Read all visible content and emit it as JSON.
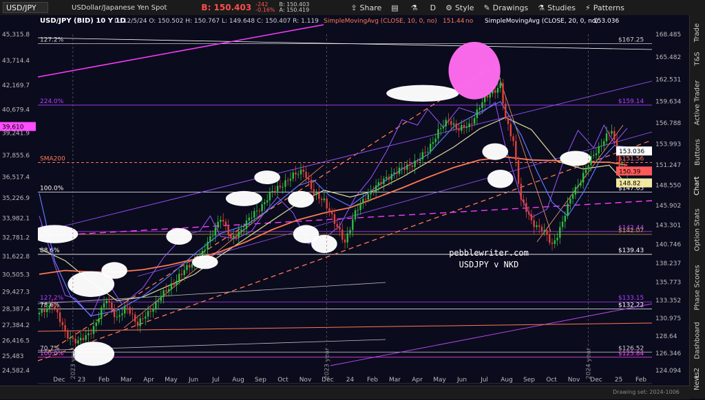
{
  "toolbar": {
    "symbol": "USD/JPY",
    "description": "USDollar/Japanese Yen Spot",
    "bid": "B: 150.403",
    "change": "-242",
    "change_pct": "-0.16%",
    "bid_small": "B: 150.403",
    "ask_small": "A: 150.419",
    "buttons": [
      "Share",
      "Style",
      "Drawings",
      "Studies",
      "Patterns"
    ],
    "period": "D"
  },
  "chart_header": {
    "title": "USD/JPY (BID) 10 Y 1D",
    "ohlc": "D: 12/5/24  O: 150.502  H: 150.767  L: 149.648  C: 150.407  R: 1.119",
    "sma10": "SimpleMovingAvg (CLOSE, 10, 0, no)",
    "sma10_val": "151.44",
    "sma10_no": "no",
    "sma20": "SimpleMovingAvg (CLOSE, 20, 0, no)",
    "sma20_val": "153.036"
  },
  "colors": {
    "background": "#0b0b1e",
    "magenta": "#ff3cff",
    "orange": "#ff7a52",
    "violet": "#9a56ff",
    "yellow_sma": "#dede9a",
    "blue_sma": "#5a7bff",
    "candle_up": "#2fbf3f",
    "candle_down": "#e0433a"
  },
  "watermark": {
    "line1": "pebblewriter.com",
    "line2": "USDJPY v NKD"
  },
  "vertical_labels": [
    "2023 year",
    "2023 year",
    "2024 year"
  ],
  "chart_data": {
    "type": "candlestick",
    "x_ticks": [
      "Dec",
      "23",
      "Feb",
      "Mar",
      "Apr",
      "May",
      "Jun",
      "Jul",
      "Aug",
      "Sep",
      "Oct",
      "Nov",
      "Dec",
      "24",
      "Feb",
      "Mar",
      "Apr",
      "May",
      "Jun",
      "Jul",
      "Aug",
      "Sep",
      "Oct",
      "Nov",
      "Dec",
      "25",
      "Feb"
    ],
    "right_axis_ticks": [
      "168.485",
      "165.482",
      "162.531",
      "159.634",
      "156.788",
      "153.993",
      "151.247",
      "148.550",
      "145.902",
      "143.301",
      "140.746",
      "138.237",
      "135.773",
      "133.352",
      "130.975",
      "128.64",
      "126.346",
      "124.094"
    ],
    "left_axis_ticks": [
      "45,315.8",
      "43,714.4",
      "42,169.7",
      "40,679.4",
      "39,241.9",
      "37,855.6",
      "36,517.4",
      "35,226.9",
      "33,982.1",
      "32,781.2",
      "31,622.8",
      "30,505.3",
      "29,427.3",
      "28,387.4",
      "27,384.2",
      "26,416.5",
      "25,483",
      "24,582.4"
    ],
    "ylim": [
      124.094,
      168.485
    ],
    "left_ylim": [
      24582.4,
      45315.8
    ],
    "price_badges": [
      {
        "label": "153.036",
        "value": 153.036,
        "color": "#ffffff"
      },
      {
        "label": "150.39",
        "value": 150.39,
        "color": "#ff5a5a"
      },
      {
        "label": "148.82",
        "value": 148.82,
        "color": "#f3e9a0"
      }
    ],
    "left_badge": {
      "label": "39,610",
      "value": 39610,
      "color": "#ff4dff"
    },
    "fib_levels": [
      {
        "pct": "127.2%",
        "price": "$167.25",
        "value": 167.25,
        "color": "#cfcfcf"
      },
      {
        "pct": "224.0%",
        "price": "$159.14",
        "value": 159.14,
        "color": "#b040ff"
      },
      {
        "pct": "SMA200",
        "price": "$151.56",
        "value": 151.56,
        "color": "#ff7a52"
      },
      {
        "pct": "100.0%",
        "price": "$147.65",
        "value": 147.65,
        "color": "#ffffff"
      },
      {
        "pct": "161.8%",
        "price": "$142.44",
        "value": 142.44,
        "color": "#c74aff"
      },
      {
        "pct": "",
        "price": "$142.07",
        "value": 142.07,
        "color": "#c9a040"
      },
      {
        "pct": "88.6%",
        "price": "$139.43",
        "value": 139.43,
        "color": "#ffffff"
      },
      {
        "pct": "127.2%",
        "price": "$133.15",
        "value": 133.15,
        "color": "#b040ff"
      },
      {
        "pct": "78.6%",
        "price": "$132.22",
        "value": 132.22,
        "color": "#ffffff"
      },
      {
        "pct": "70.7%",
        "price": "$126.52",
        "value": 126.52,
        "color": "#cfcfcf"
      },
      {
        "pct": "100.0%",
        "price": "$125.84",
        "value": 125.84,
        "color": "#ff4dff"
      }
    ],
    "usdjpy_path": [
      [
        0,
        131.5
      ],
      [
        5,
        133
      ],
      [
        10,
        129
      ],
      [
        15,
        127.8
      ],
      [
        18,
        128.5
      ],
      [
        22,
        130.4
      ],
      [
        26,
        133.5
      ],
      [
        30,
        131
      ],
      [
        34,
        132.4
      ],
      [
        38,
        130.3
      ],
      [
        42,
        131.5
      ],
      [
        46,
        133.6
      ],
      [
        50,
        134.8
      ],
      [
        54,
        136.7
      ],
      [
        58,
        137.8
      ],
      [
        62,
        139.1
      ],
      [
        66,
        141.4
      ],
      [
        70,
        144.5
      ],
      [
        74,
        141.3
      ],
      [
        78,
        142.8
      ],
      [
        82,
        144.4
      ],
      [
        86,
        146
      ],
      [
        90,
        147.6
      ],
      [
        94,
        148.8
      ],
      [
        98,
        149.7
      ],
      [
        102,
        150.7
      ],
      [
        106,
        147.2
      ],
      [
        110,
        146.7
      ],
      [
        114,
        143.5
      ],
      [
        118,
        141.2
      ],
      [
        122,
        144.8
      ],
      [
        126,
        147.2
      ],
      [
        130,
        148.2
      ],
      [
        134,
        149.7
      ],
      [
        138,
        150.2
      ],
      [
        142,
        151.2
      ],
      [
        146,
        151.6
      ],
      [
        150,
        153.4
      ],
      [
        154,
        155.5
      ],
      [
        158,
        157.3
      ],
      [
        162,
        155.8
      ],
      [
        166,
        156.5
      ],
      [
        170,
        158.9
      ],
      [
        174,
        160.8
      ],
      [
        178,
        161.7
      ],
      [
        180,
        157.2
      ],
      [
        183,
        154.5
      ],
      [
        186,
        146.5
      ],
      [
        190,
        143.8
      ],
      [
        194,
        142.8
      ],
      [
        198,
        140.6
      ],
      [
        202,
        143.7
      ],
      [
        206,
        147.6
      ],
      [
        210,
        149.9
      ],
      [
        214,
        152.6
      ],
      [
        218,
        154.6
      ],
      [
        221,
        155.7
      ],
      [
        224,
        151.2
      ],
      [
        227,
        150.4
      ]
    ],
    "nkd_path": [
      [
        0,
        144.5
      ],
      [
        6,
        138
      ],
      [
        10,
        134
      ],
      [
        14,
        133.6
      ],
      [
        20,
        131.2
      ],
      [
        26,
        136
      ],
      [
        32,
        132.8
      ],
      [
        40,
        135
      ],
      [
        48,
        139
      ],
      [
        56,
        142
      ],
      [
        62,
        142.5
      ],
      [
        66,
        144.5
      ],
      [
        70,
        141.8
      ],
      [
        76,
        141.5
      ],
      [
        82,
        142.5
      ],
      [
        86,
        144.5
      ],
      [
        92,
        147
      ],
      [
        98,
        144.9
      ],
      [
        104,
        140.8
      ],
      [
        110,
        141.5
      ],
      [
        116,
        143.2
      ],
      [
        122,
        147
      ],
      [
        128,
        149.5
      ],
      [
        134,
        153
      ],
      [
        140,
        157.2
      ],
      [
        146,
        156.5
      ],
      [
        150,
        158.6
      ],
      [
        156,
        156.2
      ],
      [
        162,
        158.8
      ],
      [
        170,
        157.9
      ],
      [
        176,
        159.5
      ],
      [
        180,
        153.6
      ],
      [
        186,
        146.9
      ],
      [
        190,
        144.3
      ],
      [
        196,
        145.4
      ],
      [
        202,
        151.4
      ],
      [
        208,
        155.8
      ],
      [
        214,
        153.5
      ],
      [
        218,
        156.5
      ],
      [
        222,
        154.1
      ],
      [
        227,
        156.1
      ]
    ],
    "sma_blue": [
      [
        0,
        147.5
      ],
      [
        6,
        138.5
      ],
      [
        12,
        134
      ],
      [
        20,
        131.3
      ],
      [
        30,
        132
      ],
      [
        40,
        133.9
      ],
      [
        50,
        136.5
      ],
      [
        60,
        139.5
      ],
      [
        70,
        142.2
      ],
      [
        80,
        143.3
      ],
      [
        90,
        145.7
      ],
      [
        100,
        148.5
      ],
      [
        106,
        149.2
      ],
      [
        112,
        147.2
      ],
      [
        120,
        145.8
      ],
      [
        130,
        148.3
      ],
      [
        140,
        150.7
      ],
      [
        150,
        152.6
      ],
      [
        160,
        156.3
      ],
      [
        170,
        158.2
      ],
      [
        178,
        159.6
      ],
      [
        186,
        155.2
      ],
      [
        192,
        150.5
      ],
      [
        198,
        146.3
      ],
      [
        204,
        144.5
      ],
      [
        210,
        147.6
      ],
      [
        216,
        151.6
      ],
      [
        222,
        153.8
      ],
      [
        227,
        153.6
      ]
    ],
    "sma_yellow": [
      [
        0,
        140.2
      ],
      [
        10,
        138.6
      ],
      [
        20,
        135.8
      ],
      [
        30,
        133.3
      ],
      [
        40,
        133.8
      ],
      [
        50,
        135.3
      ],
      [
        60,
        136.8
      ],
      [
        70,
        139.3
      ],
      [
        80,
        141.6
      ],
      [
        90,
        143.9
      ],
      [
        100,
        146.2
      ],
      [
        110,
        147.9
      ],
      [
        120,
        147
      ],
      [
        130,
        147.9
      ],
      [
        140,
        149.6
      ],
      [
        150,
        151.6
      ],
      [
        160,
        153.6
      ],
      [
        170,
        156
      ],
      [
        180,
        157.5
      ],
      [
        190,
        155.9
      ],
      [
        200,
        151.7
      ],
      [
        210,
        150.7
      ],
      [
        220,
        151.2
      ],
      [
        227,
        148.6
      ]
    ],
    "sma_red": [
      [
        0,
        136.8
      ],
      [
        10,
        137.3
      ],
      [
        20,
        137.1
      ],
      [
        30,
        137.1
      ],
      [
        40,
        137.4
      ],
      [
        50,
        138
      ],
      [
        60,
        138.8
      ],
      [
        70,
        139.8
      ],
      [
        80,
        141.1
      ],
      [
        90,
        142.7
      ],
      [
        100,
        144
      ],
      [
        110,
        144.9
      ],
      [
        120,
        145.6
      ],
      [
        130,
        146.9
      ],
      [
        140,
        148.2
      ],
      [
        150,
        149.6
      ],
      [
        160,
        150.9
      ],
      [
        170,
        151.9
      ],
      [
        180,
        152.3
      ],
      [
        190,
        151.9
      ],
      [
        200,
        151.8
      ],
      [
        210,
        151.6
      ],
      [
        220,
        151.6
      ],
      [
        227,
        151.2
      ]
    ],
    "vertical_markers": [
      13,
      111,
      212
    ],
    "highlight_ellipses": [
      [
        6,
        142.1,
        9,
        1.2
      ],
      [
        20,
        135.5,
        9,
        1.7
      ],
      [
        29,
        137.3,
        5,
        1.1
      ],
      [
        21,
        126.3,
        8,
        1.6
      ],
      [
        54,
        141.8,
        5,
        1.1
      ],
      [
        64,
        138.4,
        5,
        0.9
      ],
      [
        79,
        146.8,
        7,
        1.0
      ],
      [
        88,
        149.6,
        5,
        0.9
      ],
      [
        101,
        146.7,
        5,
        1.1
      ],
      [
        103,
        142.1,
        5,
        1.2
      ],
      [
        110,
        140.8,
        5,
        1.2
      ],
      [
        148,
        160.7,
        14,
        1.1
      ],
      [
        168,
        163.7,
        10,
        3.8
      ],
      [
        176,
        153,
        5,
        1.1
      ],
      [
        178,
        149.4,
        5,
        1.2
      ],
      [
        207,
        152.1,
        6,
        1.0
      ]
    ]
  },
  "bottom": {
    "drawing_set": "Drawing set: 2024-1006"
  },
  "right_panel_tabs": [
    "Trade",
    "T&S",
    "Active Trader",
    "Buttons",
    "Chart",
    "Option Stats",
    "Phase Scores",
    "Dashboard",
    "L 2",
    "News"
  ]
}
